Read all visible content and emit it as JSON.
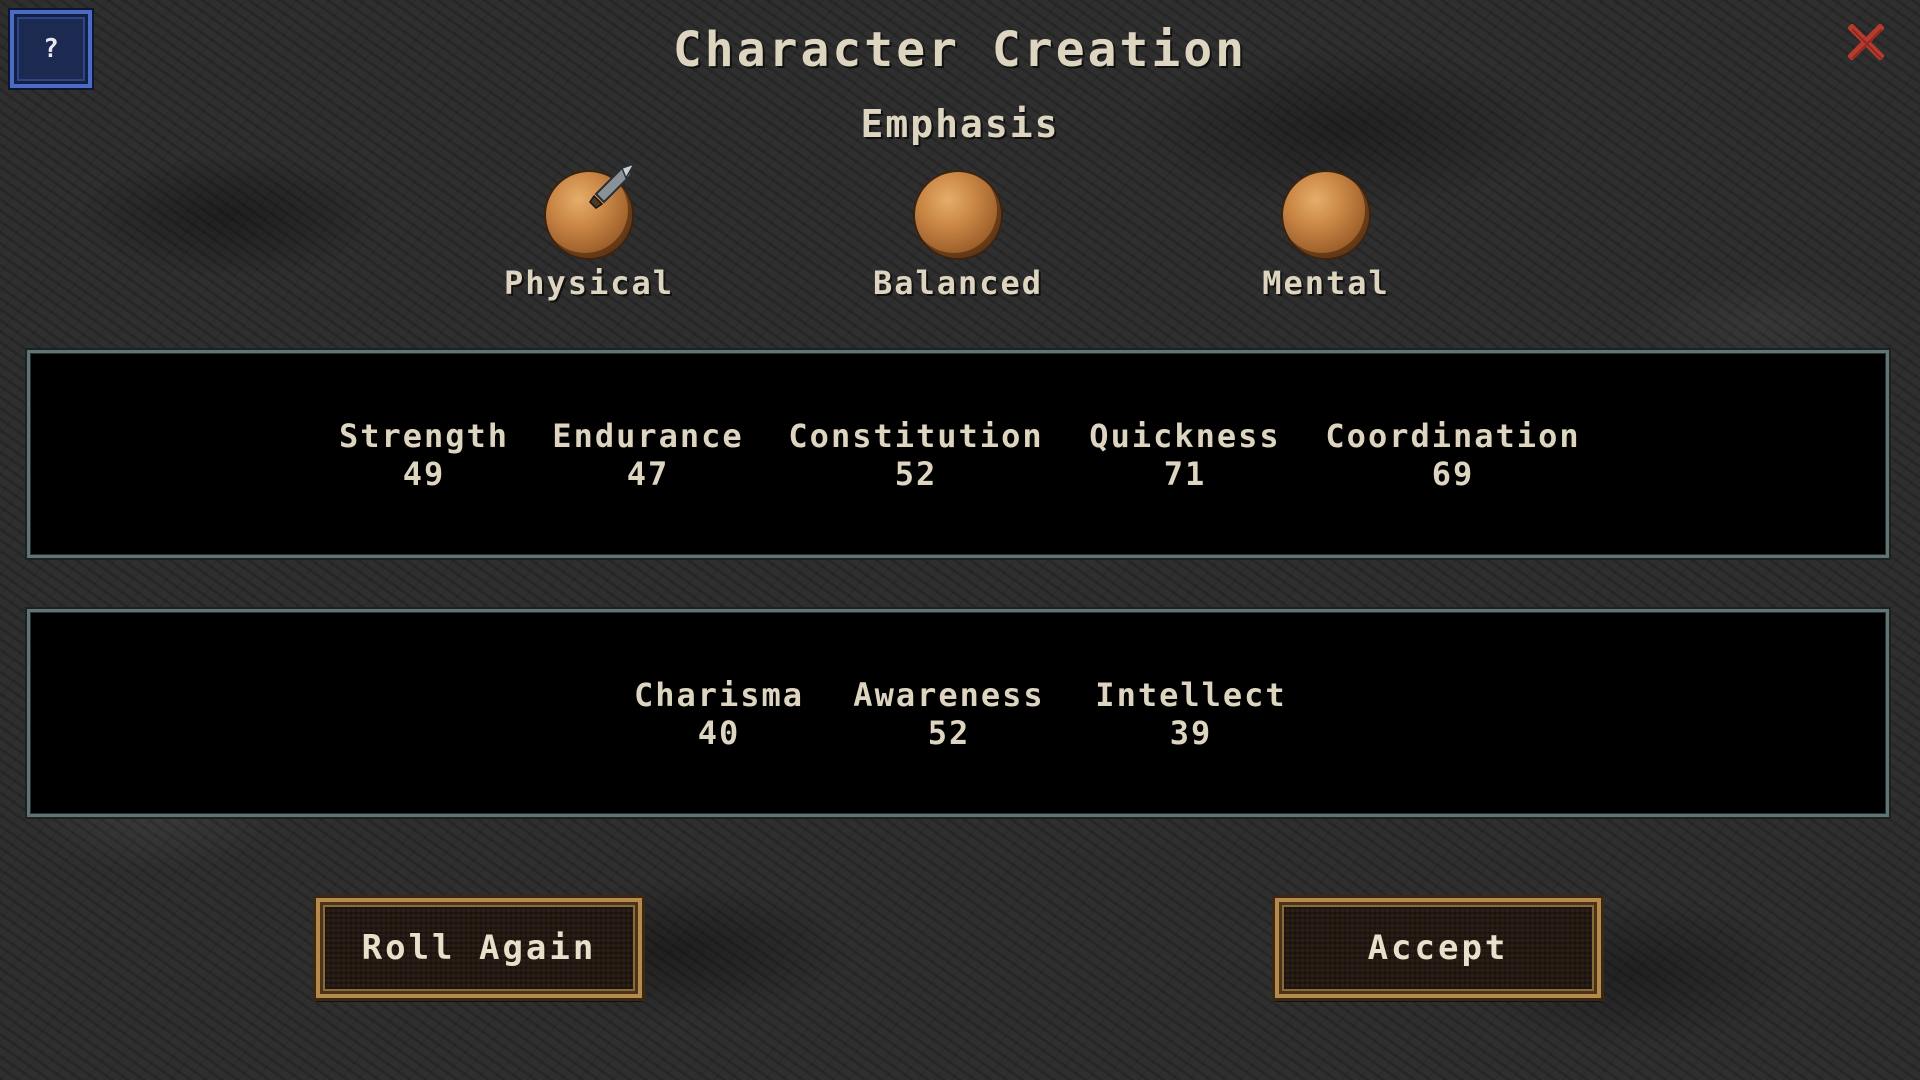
{
  "header": {
    "help_label": "?",
    "title": "Character Creation",
    "close_label": "X"
  },
  "emphasis": {
    "heading": "Emphasis",
    "selected": "Physical",
    "options": [
      {
        "label": "Physical"
      },
      {
        "label": "Balanced"
      },
      {
        "label": "Mental"
      }
    ]
  },
  "physical_stats": [
    {
      "name": "Strength",
      "value": "49"
    },
    {
      "name": "Endurance",
      "value": "47"
    },
    {
      "name": "Constitution",
      "value": "52"
    },
    {
      "name": "Quickness",
      "value": "71"
    },
    {
      "name": "Coordination",
      "value": "69"
    }
  ],
  "mental_stats": [
    {
      "name": "Charisma",
      "value": "40"
    },
    {
      "name": "Awareness",
      "value": "52"
    },
    {
      "name": "Intellect",
      "value": "39"
    }
  ],
  "actions": {
    "roll_again": "Roll Again",
    "accept": "Accept"
  },
  "colors": {
    "text": "#ded5c0",
    "help_button": "#1c2a52",
    "close": "#b83a2e",
    "orb": "#c98645",
    "button_border": "#b58a4c"
  }
}
